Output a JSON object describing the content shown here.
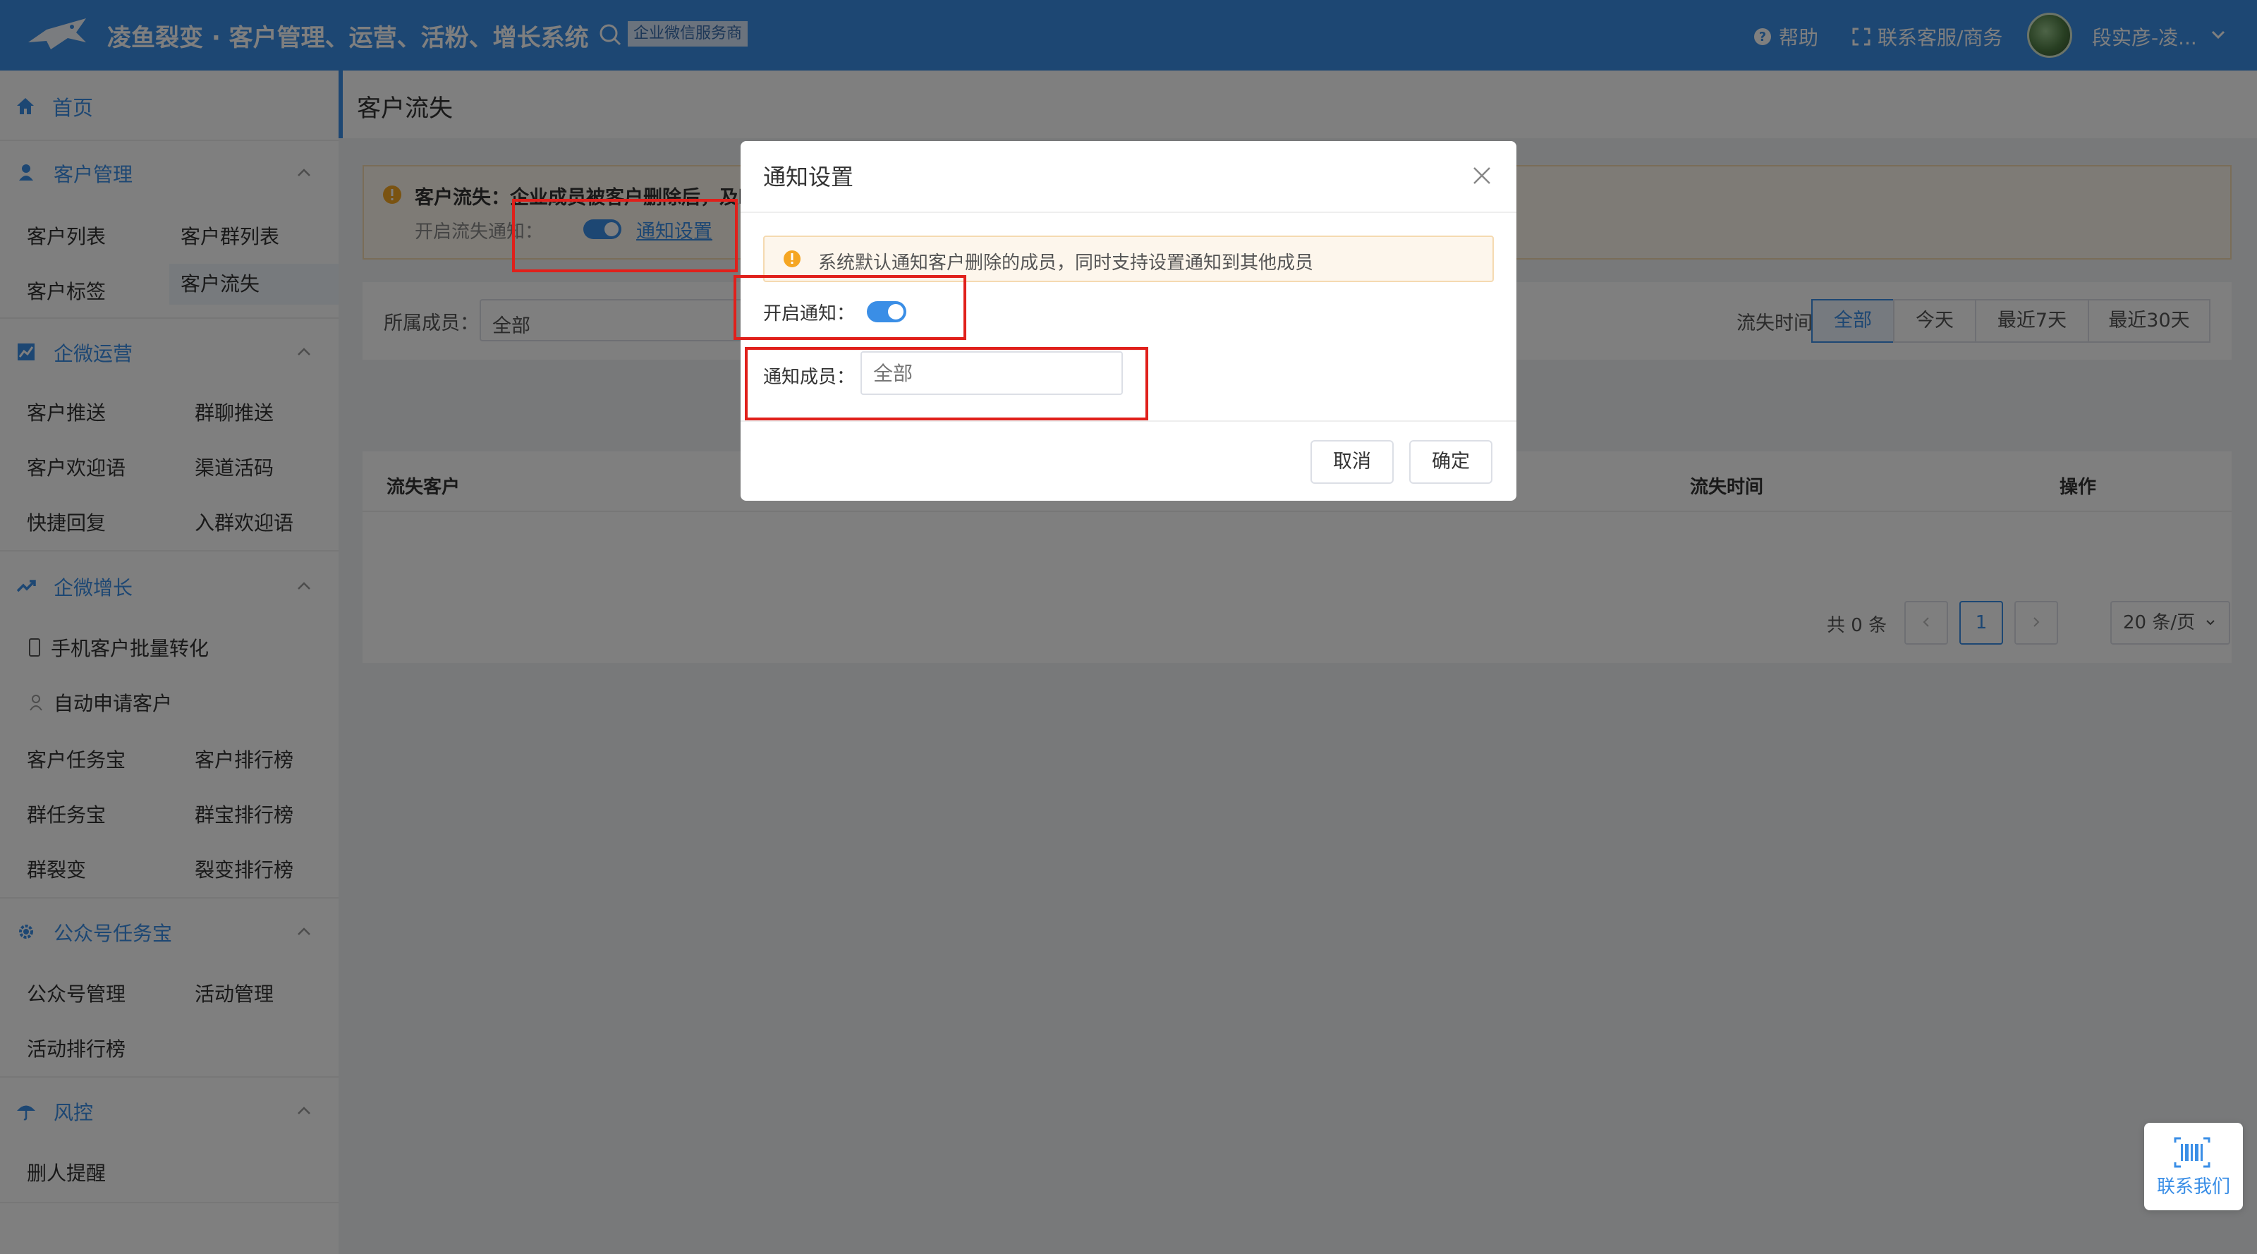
{
  "header": {
    "app_title": "凌鱼裂变 · 客户管理、运营、活粉、增长系统",
    "vendor_badge": "企业微信服务商",
    "help": "帮助",
    "contact_service": "联系客服/商务",
    "user_name": "段实彦-凌..."
  },
  "sidebar": {
    "home": "首页",
    "groups": [
      {
        "label": "客户管理",
        "items": [
          "客户列表",
          "客户群列表",
          "客户标签",
          "客户流失"
        ]
      },
      {
        "label": "企微运营",
        "items": [
          "客户推送",
          "群聊推送",
          "客户欢迎语",
          "渠道活码",
          "快捷回复",
          "入群欢迎语"
        ]
      },
      {
        "label": "企微增长",
        "items": [
          "手机客户批量转化",
          "自动申请客户",
          "客户任务宝",
          "客户排行榜",
          "群任务宝",
          "群宝排行榜",
          "群裂变",
          "裂变排行榜"
        ]
      },
      {
        "label": "公众号任务宝",
        "items": [
          "公众号管理",
          "活动管理",
          "活动排行榜"
        ]
      },
      {
        "label": "风控",
        "items": [
          "删人提醒"
        ]
      }
    ]
  },
  "page": {
    "title": "客户流失",
    "notice": {
      "title": "客户流失：企业成员被客户删除后，及时",
      "toggle_label": "开启流失通知：",
      "link": "通知设置"
    },
    "filters": {
      "member_label": "所属成员：",
      "member_value": "全部",
      "time_label": "流失时间：",
      "time_options": [
        "全部",
        "今天",
        "最近7天",
        "最近30天"
      ],
      "time_selected": 0
    },
    "table": {
      "columns": [
        "流失客户",
        "流失时间",
        "操作"
      ]
    },
    "pagination": {
      "total": "共 0 条",
      "current_page": "1",
      "page_size": "20 条/页"
    }
  },
  "dialog": {
    "title": "通知设置",
    "alert": "系统默认通知客户删除的成员，同时支持设置通知到其他成员",
    "notify_label": "开启通知：",
    "notify_enabled": true,
    "members_label": "通知成员：",
    "members_placeholder": "全部",
    "cancel": "取消",
    "ok": "确定"
  },
  "float_contact": {
    "label": "联系我们"
  },
  "colors": {
    "primary": "#3a8ee6",
    "highlight": "#e0201b",
    "warning": "#f5a623"
  }
}
